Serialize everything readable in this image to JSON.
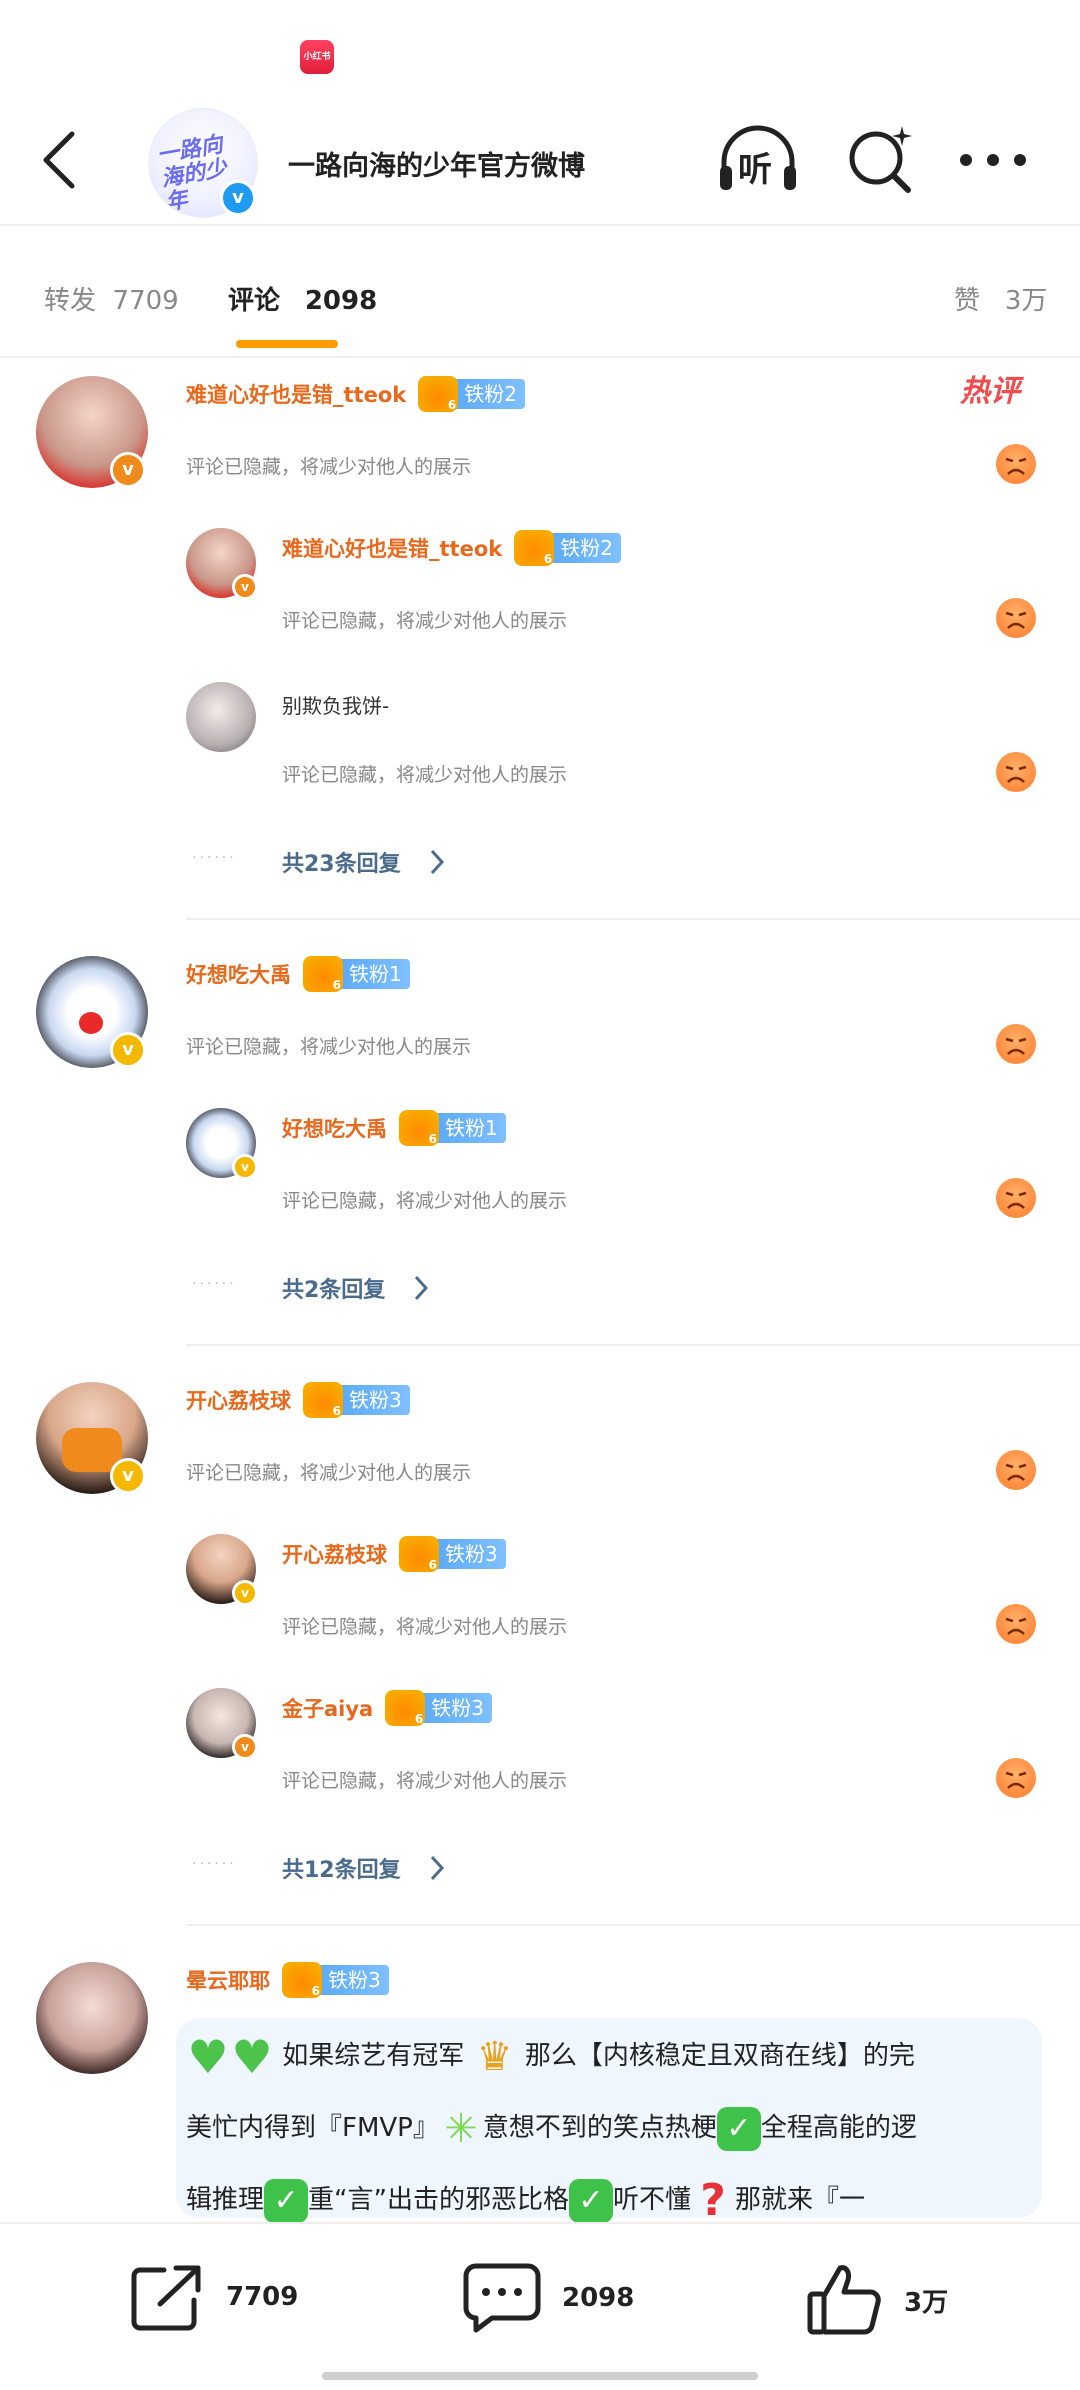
{
  "header": {
    "title": "一路向海的少年官方微博",
    "avatar_text": "一路向海的少年",
    "listen_label": "听"
  },
  "tabs": {
    "repost_label": "转发",
    "repost_count": "7709",
    "comment_label": "评论",
    "comment_count": "2098",
    "like_label": "赞",
    "like_count": "3万"
  },
  "hot_label": "热评",
  "hidden_text": "评论已隐藏，将减少对他人的展示",
  "threads": [
    {
      "name": "难道心好也是错_tteok",
      "fan": "铁粉2",
      "replies": [
        {
          "name": "难道心好也是错_tteok",
          "fan": "铁粉2"
        },
        {
          "name": "别欺负我饼-"
        }
      ],
      "more": "共23条回复"
    },
    {
      "name": "好想吃大禹",
      "fan": "铁粉1",
      "replies": [
        {
          "name": "好想吃大禹",
          "fan": "铁粉1"
        }
      ],
      "more": "共2条回复"
    },
    {
      "name": "开心荔枝球",
      "fan": "铁粉3",
      "replies": [
        {
          "name": "开心荔枝球",
          "fan": "铁粉3"
        },
        {
          "name": "金子aiya",
          "fan": "铁粉3"
        }
      ],
      "more": "共12条回复"
    }
  ],
  "last_comment": {
    "name": "晕云耶耶",
    "fan": "铁粉3",
    "line1": "如果综艺有冠军",
    "line1b": "那么【内核稳定且双商在线】的完",
    "line2a": "美忙内得到『FMVP』",
    "line2b": "意想不到的笑点热梗",
    "line2c": "全程高能的逻",
    "line3a": "辑推理",
    "line3b": "重“言”出击的邪恶比格",
    "line3c": "听不懂",
    "line3d": "那就来『一"
  },
  "bottom_bar": {
    "repost_count": "7709",
    "comment_count": "2098",
    "like_count": "3万"
  },
  "colors": {
    "accent": "#ff9a00",
    "username": "#e8681c",
    "fan_badge": "#5aa9f5",
    "verified": "#1e9bf0"
  }
}
